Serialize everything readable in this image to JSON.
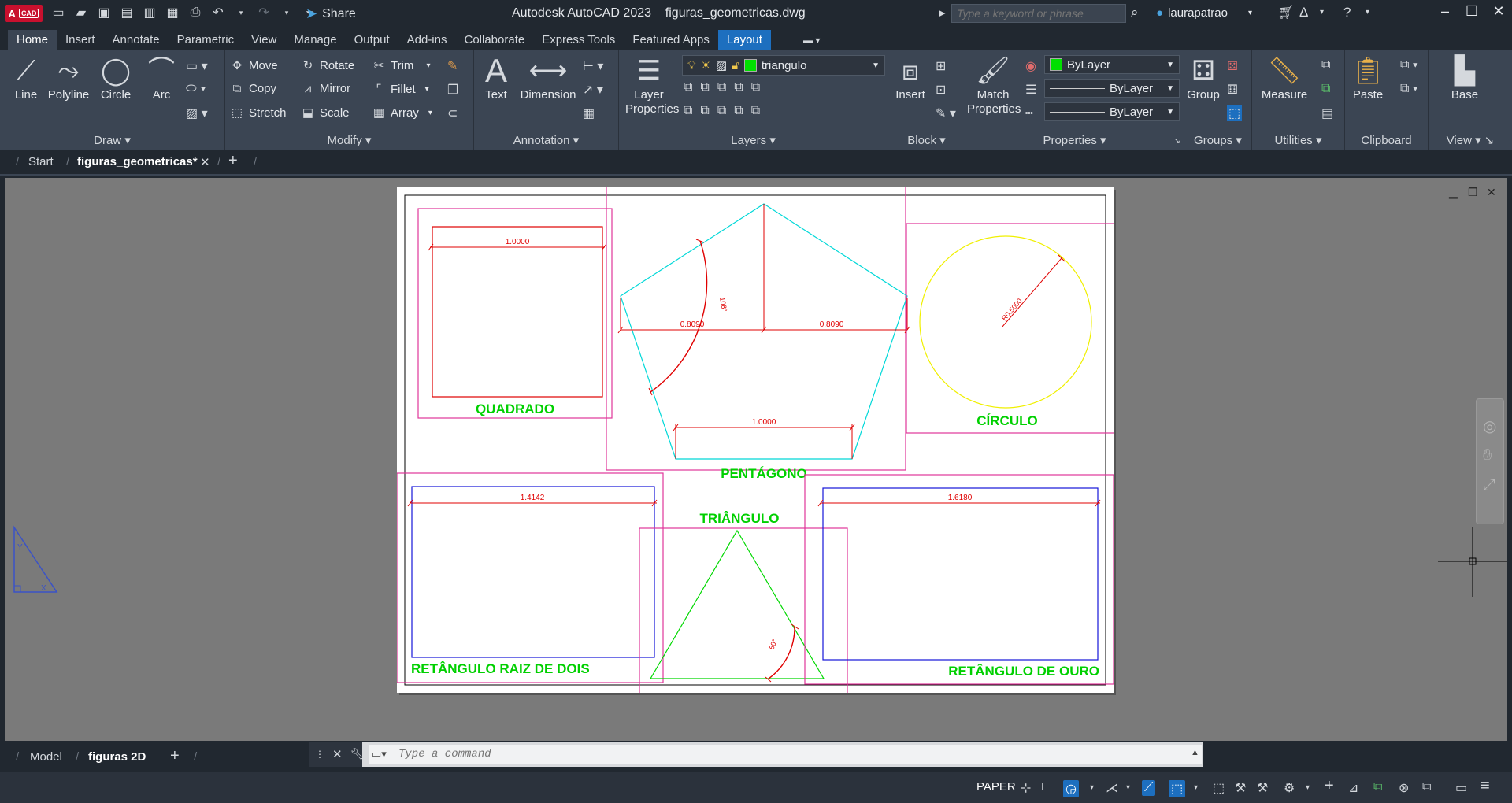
{
  "app": {
    "logo": "A",
    "logo_sub": "CAD",
    "title": "Autodesk AutoCAD 2023",
    "filename": "figuras_geometricas.dwg",
    "share_label": "Share",
    "search_placeholder": "Type a keyword or phrase",
    "username": "laurapatrao"
  },
  "ribbon_tabs": [
    "Home",
    "Insert",
    "Annotate",
    "Parametric",
    "View",
    "Manage",
    "Output",
    "Add-ins",
    "Collaborate",
    "Express Tools",
    "Featured Apps",
    "Layout"
  ],
  "ribbon": {
    "draw": {
      "title": "Draw",
      "line": "Line",
      "polyline": "Polyline",
      "circle": "Circle",
      "arc": "Arc"
    },
    "modify": {
      "title": "Modify",
      "move": "Move",
      "rotate": "Rotate",
      "trim": "Trim",
      "copy": "Copy",
      "mirror": "Mirror",
      "fillet": "Fillet",
      "stretch": "Stretch",
      "scale": "Scale",
      "array": "Array"
    },
    "annotation": {
      "title": "Annotation",
      "text": "Text",
      "dimension": "Dimension"
    },
    "layers": {
      "title": "Layers",
      "layer_properties": "Layer Properties",
      "current_layer": "triangulo"
    },
    "block": {
      "title": "Block",
      "insert": "Insert"
    },
    "properties": {
      "title": "Properties",
      "match": "Match Properties",
      "color": "ByLayer",
      "linetype": "ByLayer",
      "lineweight": "ByLayer"
    },
    "groups": {
      "title": "Groups",
      "group": "Group"
    },
    "utilities": {
      "title": "Utilities",
      "measure": "Measure"
    },
    "clipboard": {
      "title": "Clipboard",
      "paste": "Paste"
    },
    "view": {
      "title": "View",
      "base": "Base"
    }
  },
  "file_tabs": {
    "start": "Start",
    "active": "figuras_geometricas*"
  },
  "drawing": {
    "quadrado": "QUADRADO",
    "pentagono": "PENTÁGONO",
    "circulo": "CÍRCULO",
    "triangulo": "TRIÂNGULO",
    "ret_raiz": "RETÂNGULO RAIZ DE DOIS",
    "ret_ouro": "RETÂNGULO DE OURO",
    "dim_square": "1.0000",
    "dim_pent_left": "0.8090",
    "dim_pent_right": "0.8090",
    "dim_pent_bottom": "1.0000",
    "dim_pent_angle": "108°",
    "dim_circle": "R0.5000",
    "dim_raiz": "1.4142",
    "dim_ouro": "1.6180",
    "dim_tri_angle": "60°"
  },
  "layout_tabs": {
    "model": "Model",
    "active": "figuras 2D"
  },
  "command": {
    "placeholder": "Type a command"
  },
  "status": {
    "space": "PAPER"
  },
  "colors": {
    "accent": "#1d6fbf",
    "bg": "#212830",
    "ribbon": "#3b4553",
    "canvas": "#7a7a7a"
  }
}
